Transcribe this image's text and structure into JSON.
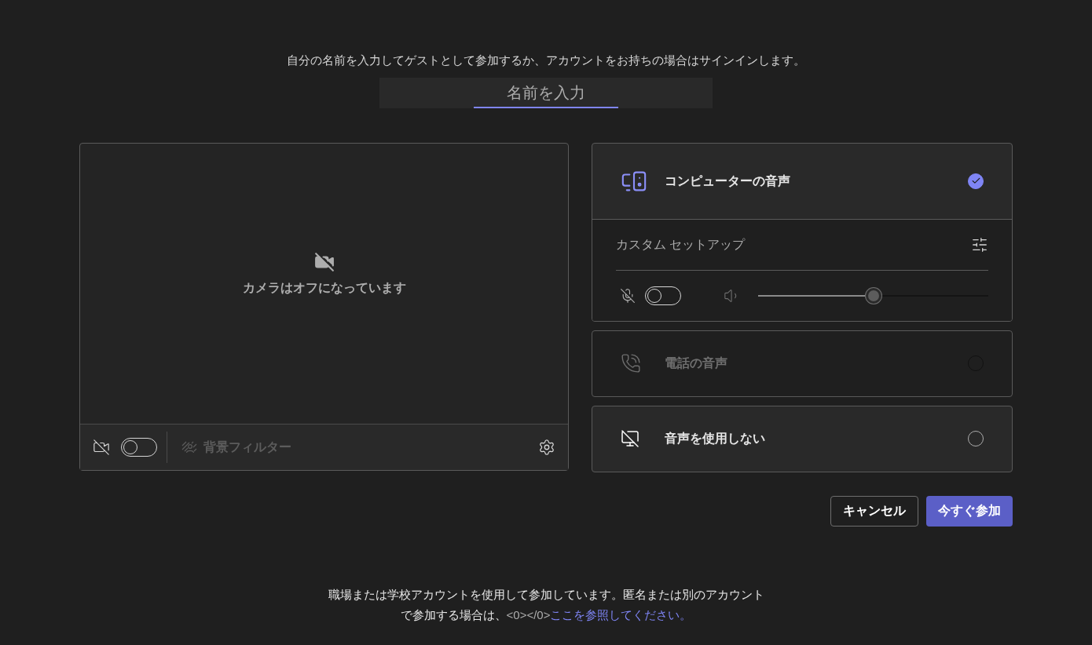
{
  "prompt": "自分の名前を入力してゲストとして参加するか、アカウントをお持ちの場合はサインインします。",
  "name_field": {
    "placeholder": "名前を入力",
    "focused": true
  },
  "camera": {
    "status": "カメラはオフになっています",
    "on": false,
    "background_filter": {
      "label": "背景フィルター",
      "disabled": true
    }
  },
  "audio_options": [
    {
      "kind": "computer",
      "label": "コンピューターの音声",
      "selected": true,
      "disabled": false,
      "setup": {
        "label": "カスタム セットアップ",
        "mic_on": false,
        "level": 0.5
      }
    },
    {
      "kind": "phone",
      "label": "電話の音声",
      "selected": false,
      "disabled": true
    },
    {
      "kind": "none",
      "label": "音声を使用しない",
      "selected": false,
      "disabled": false
    }
  ],
  "buttons": [
    {
      "label": "キャンセル",
      "kind": "secondary"
    },
    {
      "label": "今すぐ参加",
      "kind": "primary"
    }
  ],
  "footer": {
    "text": "職場または学校アカウントを使用して参加しています。匿名または別のアカウントで参加する場合は、",
    "tag": "<0></0>",
    "link": "ここを参照してください。"
  }
}
